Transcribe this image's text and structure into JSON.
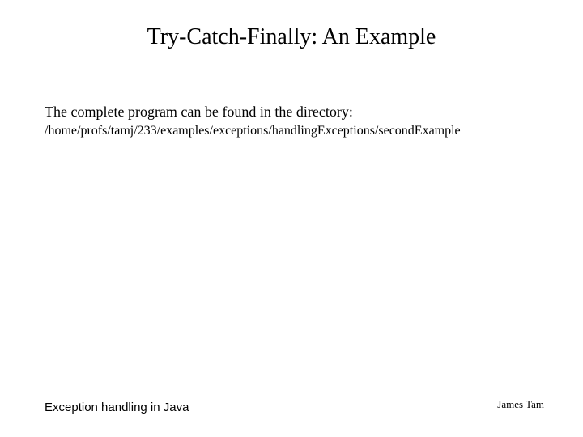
{
  "slide": {
    "title": "Try-Catch-Finally: An Example",
    "body": "The complete program can be found in the directory:",
    "path": "/home/profs/tamj/233/examples/exceptions/handlingExceptions/secondExample",
    "footer_left": "Exception handling in Java",
    "footer_right": "James Tam"
  }
}
